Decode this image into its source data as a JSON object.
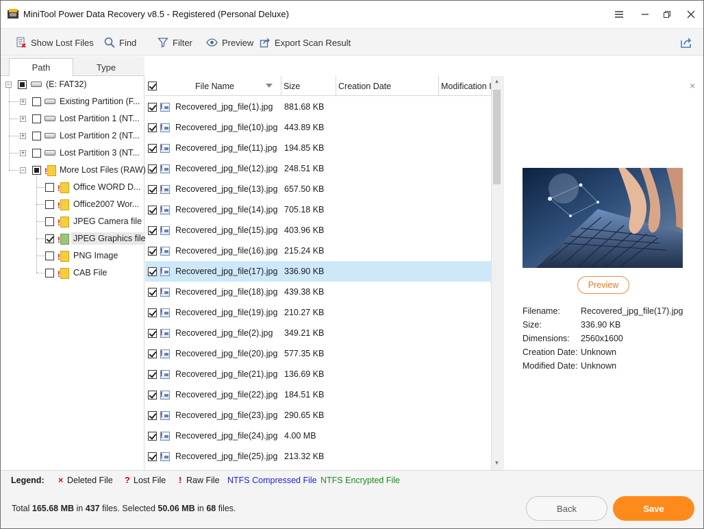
{
  "window": {
    "title": "MiniTool Power Data Recovery v8.5 - Registered (Personal Deluxe)"
  },
  "toolbar": {
    "show_lost_files": "Show Lost Files",
    "find": "Find",
    "filter": "Filter",
    "preview": "Preview",
    "export_scan_result": "Export Scan Result"
  },
  "left_tabs": {
    "path": "Path",
    "type": "Type"
  },
  "tree": {
    "root": "(E: FAT32)",
    "partitions": [
      "Existing Partition (F...",
      "Lost Partition 1 (NT...",
      "Lost Partition 2 (NT...",
      "Lost Partition 3 (NT..."
    ],
    "more_lost": "More Lost Files (RAW)",
    "raw_types": [
      "Office WORD D...",
      "Office2007 Wor...",
      "JPEG Camera file",
      "JPEG Graphics file",
      "PNG Image",
      "CAB File"
    ]
  },
  "file_table": {
    "columns": {
      "name": "File Name",
      "size": "Size",
      "created": "Creation Date",
      "modified": "Modification I"
    },
    "rows": [
      {
        "name": "Recovered_jpg_file(1).jpg",
        "size": "881.68 KB"
      },
      {
        "name": "Recovered_jpg_file(10).jpg",
        "size": "443.89 KB"
      },
      {
        "name": "Recovered_jpg_file(11).jpg",
        "size": "194.85 KB"
      },
      {
        "name": "Recovered_jpg_file(12).jpg",
        "size": "248.51 KB"
      },
      {
        "name": "Recovered_jpg_file(13).jpg",
        "size": "657.50 KB"
      },
      {
        "name": "Recovered_jpg_file(14).jpg",
        "size": "705.18 KB"
      },
      {
        "name": "Recovered_jpg_file(15).jpg",
        "size": "403.96 KB"
      },
      {
        "name": "Recovered_jpg_file(16).jpg",
        "size": "215.24 KB"
      },
      {
        "name": "Recovered_jpg_file(17).jpg",
        "size": "336.90 KB"
      },
      {
        "name": "Recovered_jpg_file(18).jpg",
        "size": "439.38 KB"
      },
      {
        "name": "Recovered_jpg_file(19).jpg",
        "size": "210.27 KB"
      },
      {
        "name": "Recovered_jpg_file(2).jpg",
        "size": "349.21 KB"
      },
      {
        "name": "Recovered_jpg_file(20).jpg",
        "size": "577.35 KB"
      },
      {
        "name": "Recovered_jpg_file(21).jpg",
        "size": "136.69 KB"
      },
      {
        "name": "Recovered_jpg_file(22).jpg",
        "size": "184.51 KB"
      },
      {
        "name": "Recovered_jpg_file(23).jpg",
        "size": "290.65 KB"
      },
      {
        "name": "Recovered_jpg_file(24).jpg",
        "size": "4.00 MB"
      },
      {
        "name": "Recovered_jpg_file(25).jpg",
        "size": "213.32 KB"
      }
    ]
  },
  "preview_panel": {
    "button": "Preview",
    "labels": {
      "filename": "Filename:",
      "size": "Size:",
      "dimensions": "Dimensions:",
      "created": "Creation Date:",
      "modified": "Modified Date:"
    },
    "values": {
      "filename": "Recovered_jpg_file(17).jpg",
      "size": "336.90 KB",
      "dimensions": "2560x1600",
      "created": "Unknown",
      "modified": "Unknown"
    }
  },
  "legend": {
    "title": "Legend:",
    "deleted_mark": "×",
    "deleted": "Deleted File",
    "lost_mark": "?",
    "lost": "Lost File",
    "raw_mark": "!",
    "raw": "Raw File",
    "ntfs_compressed": "NTFS Compressed File",
    "ntfs_encrypted": "NTFS Encrypted File"
  },
  "status": {
    "total_label": "Total",
    "total_size": "165.68 MB",
    "in1": "in",
    "total_files": "437",
    "files_selected": "files. Selected",
    "selected_size": "50.06 MB",
    "in2": "in",
    "selected_files": "68",
    "files_end": "files."
  },
  "buttons": {
    "back": "Back",
    "save": "Save"
  },
  "colors": {
    "accent_orange": "#ff8a1c",
    "selected_row": "#cde9f9",
    "legend_red": "#e00000",
    "legend_blue": "#2323d6",
    "legend_green": "#1e8a1e"
  }
}
